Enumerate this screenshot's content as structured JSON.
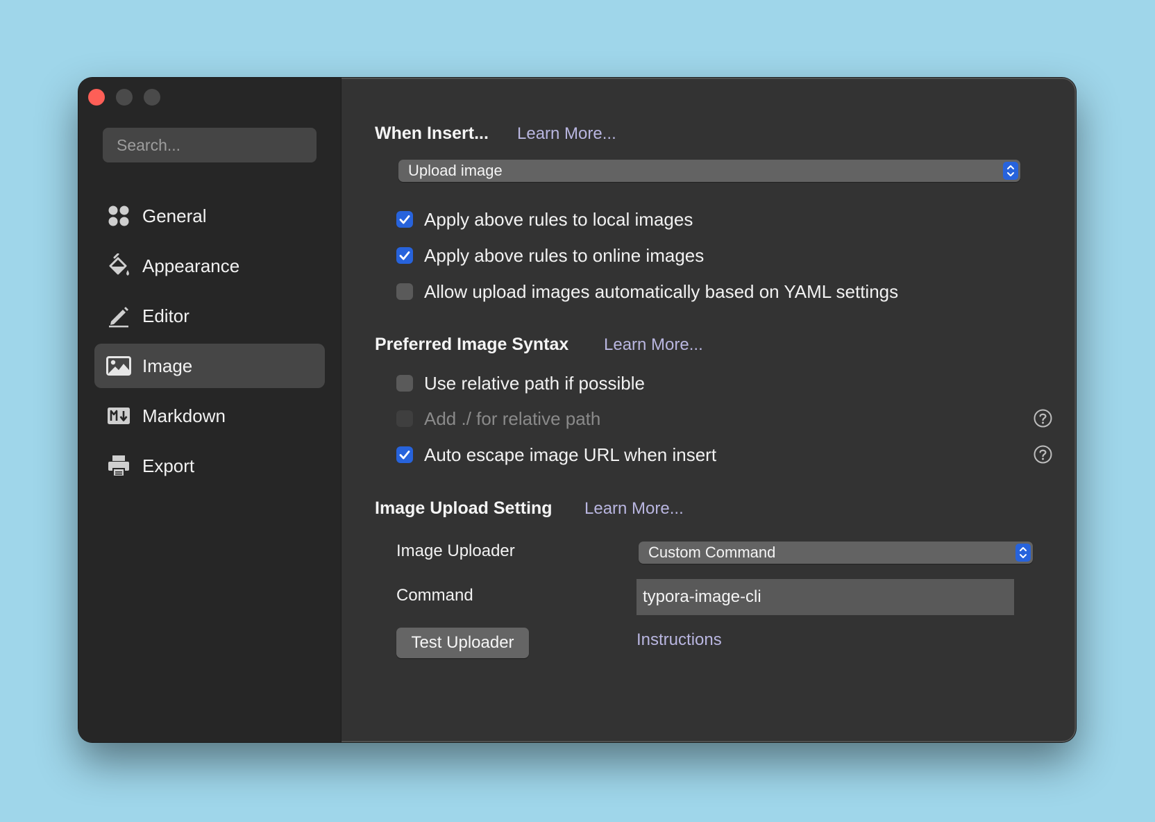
{
  "window": {
    "traffic_lights": [
      "close",
      "minimize",
      "maximize"
    ]
  },
  "sidebar": {
    "search_placeholder": "Search...",
    "items": [
      {
        "label": "General",
        "icon": "grid-icon",
        "active": false
      },
      {
        "label": "Appearance",
        "icon": "paint-bucket-icon",
        "active": false
      },
      {
        "label": "Editor",
        "icon": "pencil-icon",
        "active": false
      },
      {
        "label": "Image",
        "icon": "image-icon",
        "active": true
      },
      {
        "label": "Markdown",
        "icon": "markdown-icon",
        "active": false
      },
      {
        "label": "Export",
        "icon": "printer-icon",
        "active": false
      }
    ]
  },
  "when_insert": {
    "title": "When Insert...",
    "learn_more": "Learn More...",
    "select_value": "Upload image",
    "options": [
      {
        "label": "Apply above rules to local images",
        "checked": true,
        "enabled": true
      },
      {
        "label": "Apply above rules to online images",
        "checked": true,
        "enabled": true
      },
      {
        "label": "Allow upload images automatically based on YAML settings",
        "checked": false,
        "enabled": true
      }
    ]
  },
  "syntax": {
    "title": "Preferred Image Syntax",
    "learn_more": "Learn More...",
    "options": [
      {
        "label": "Use relative path if possible",
        "checked": false,
        "enabled": true,
        "help": false
      },
      {
        "label": "Add ./ for relative path",
        "checked": false,
        "enabled": false,
        "help": true
      },
      {
        "label": "Auto escape image URL when insert",
        "checked": true,
        "enabled": true,
        "help": true
      }
    ]
  },
  "upload": {
    "title": "Image Upload Setting",
    "learn_more": "Learn More...",
    "uploader_label": "Image Uploader",
    "uploader_value": "Custom Command",
    "command_label": "Command",
    "command_value": "typora-image-cli",
    "test_button": "Test Uploader",
    "instructions_link": "Instructions"
  },
  "colors": {
    "accent": "#2763dc",
    "link": "#b9b6e0",
    "close": "#fe5f57"
  }
}
